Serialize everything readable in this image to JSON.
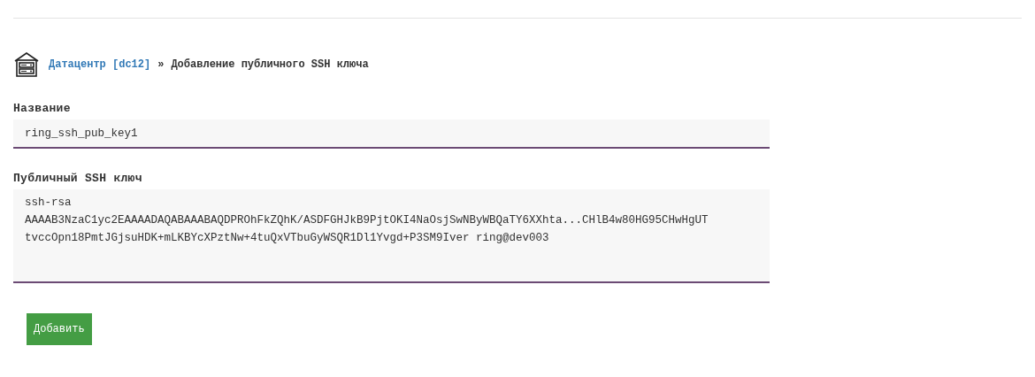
{
  "breadcrumb": {
    "link": "Датацентр [dc12]",
    "separator": "»",
    "current": "Добавление публичного SSH ключа"
  },
  "fields": [
    {
      "kind": "input",
      "label": "Название",
      "value": "ring_ssh_pub_key1"
    },
    {
      "kind": "textarea",
      "label": "Публичный SSH ключ",
      "value": "ssh-rsa\nAAAAB3NzaC1yc2EAAAADAQABAAABAQDPROhFkZQhK/ASDFGHJkB9PjtOKI4NaOsjSwNByWBQaTY6XXhta...CHlB4w80HG95CHwHgUT\ntvccOpn18PmtJGjsuHDK+mLKBYcXPztNw+4tuQxVTbuGyWSQR1Dl1Yvgd+P3SM9Iver ring@dev003"
    }
  ],
  "submit": "Добавить"
}
